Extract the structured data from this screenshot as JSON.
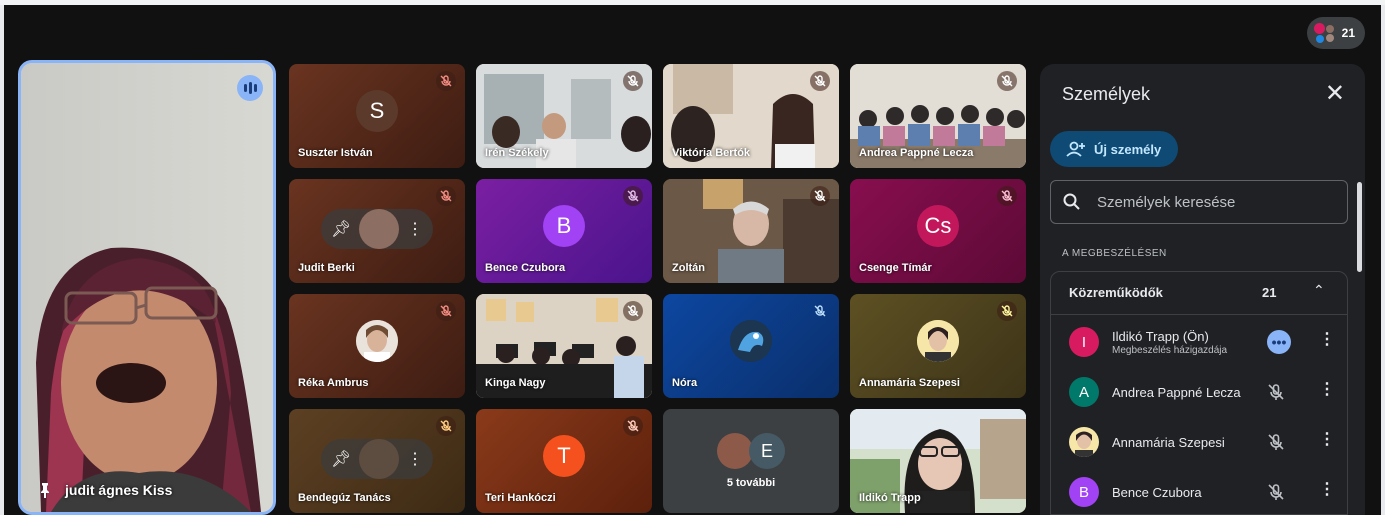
{
  "header": {
    "participant_count": "21"
  },
  "main_speaker": {
    "name": "judit ágnes Kiss"
  },
  "tiles": [
    {
      "name": "Suszter István",
      "initial": "S",
      "avatar_color": "#5b3a2c"
    },
    {
      "name": "Irén Székely"
    },
    {
      "name": "Viktória Bertók"
    },
    {
      "name": "Andrea Pappné Lecza"
    },
    {
      "name": "Judit Berki"
    },
    {
      "name": "Bence Czubora",
      "initial": "B",
      "avatar_color": "#a142f4"
    },
    {
      "name": "Zoltán"
    },
    {
      "name": "Csenge Tímár",
      "initial": "Cs",
      "avatar_color": "#c2185b"
    },
    {
      "name": "Réka Ambrus"
    },
    {
      "name": "Kinga Nagy"
    },
    {
      "name": "Nóra"
    },
    {
      "name": "Annamária Szepesi"
    },
    {
      "name": "Bendegúz Tanács"
    },
    {
      "name": "Teri Hankóczi",
      "initial": "T",
      "avatar_color": "#f4511e"
    },
    {
      "name": "5 további",
      "initial": "E",
      "avatar_color": "#455a64"
    },
    {
      "name": "Ildikó Trapp"
    }
  ],
  "panel": {
    "title": "Személyek",
    "add_button": "Új személy",
    "search_placeholder": "Személyek keresése",
    "section_label": "A MEGBESZÉLÉSEN",
    "group_label": "Közreműködők",
    "group_count": "21",
    "people": [
      {
        "name": "Ildikó Trapp (Ön)",
        "subtitle": "Megbeszélés házigazdája",
        "initial": "I",
        "color": "#d81b60"
      },
      {
        "name": "Andrea Pappné Lecza",
        "initial": "A",
        "color": "#00796b"
      },
      {
        "name": "Annamária Szepesi",
        "initial": "",
        "color": "#f6e7a8"
      },
      {
        "name": "Bence Czubora",
        "initial": "B",
        "color": "#a142f4"
      }
    ]
  },
  "colors": {
    "accent": "#8ab4f8",
    "panel_bg": "#202124",
    "stage_bg": "#111111"
  }
}
